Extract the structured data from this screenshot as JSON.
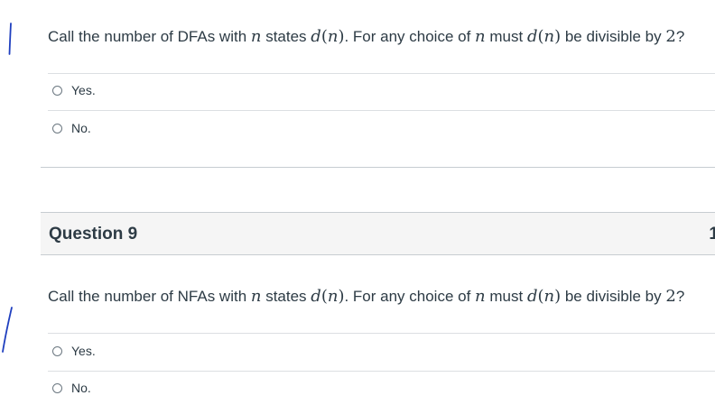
{
  "question8": {
    "text_a": "Call the number of DFAs with ",
    "n1": "n",
    "text_b": " states ",
    "d1": "d",
    "paren_open1": "(",
    "n2": "n",
    "paren_close1": ")",
    "text_c": ". For any choice of ",
    "n3": "n",
    "text_d": " must  ",
    "d2": "d",
    "paren_open2": "(",
    "n4": "n",
    "paren_close2": ")",
    "text_e": " be divisible by ",
    "two": "2",
    "qmark": "?",
    "answers": [
      "Yes.",
      "No."
    ]
  },
  "question9": {
    "title": "Question 9",
    "points": "1",
    "text_a": "Call the number of NFAs with ",
    "n1": "n",
    "text_b": " states ",
    "d1": "d",
    "paren_open1": "(",
    "n2": "n",
    "paren_close1": ")",
    "text_c": ". For any choice of ",
    "n3": "n",
    "text_d": " must  ",
    "d2": "d",
    "paren_open2": "(",
    "n4": "n",
    "paren_close2": ")",
    "text_e": " be divisible by ",
    "two": "2",
    "qmark": "?",
    "answers": [
      "Yes.",
      "No."
    ]
  },
  "colors": {
    "pen": "#1f3fbf",
    "text": "#2d3b45",
    "header_bg": "#f5f5f5"
  },
  "icons": [
    "pen-annotation-icon",
    "radio-button-icon"
  ]
}
